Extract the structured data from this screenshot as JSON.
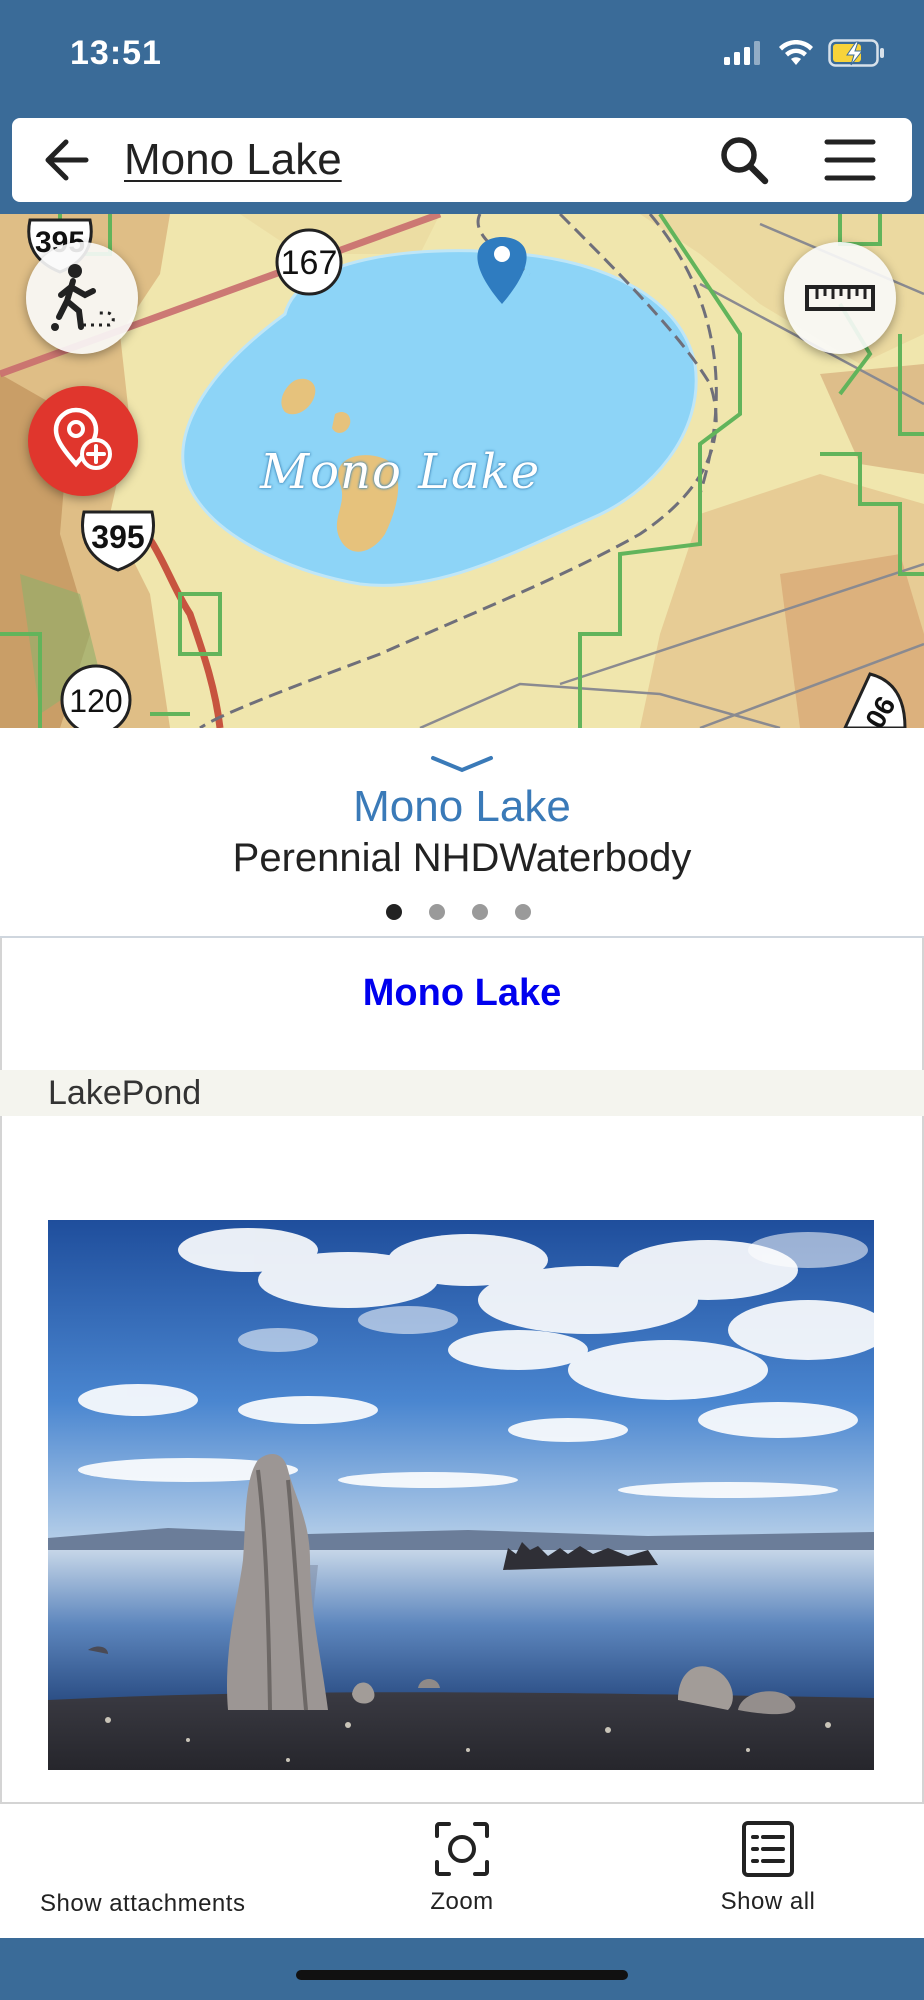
{
  "status": {
    "time": "13:51"
  },
  "header": {
    "title": "Mono Lake"
  },
  "map": {
    "label": "Mono Lake",
    "route_shields": [
      "395",
      "167",
      "395",
      "120",
      "06"
    ]
  },
  "feature": {
    "name": "Mono Lake",
    "type": "Perennial NHDWaterbody",
    "page_count": 4,
    "current_page": 1
  },
  "popup": {
    "title": "Mono Lake",
    "attribute": "LakePond"
  },
  "toolbar": {
    "attachments_label": "Show attachments",
    "zoom_label": "Zoom",
    "show_all_label": "Show all"
  },
  "colors": {
    "status_bar": "#3a6b98",
    "lake": "#8dd4f7",
    "accent_link": "#3a7ab8",
    "popup_title": "#0000ee",
    "fab_red": "#e0362d"
  }
}
